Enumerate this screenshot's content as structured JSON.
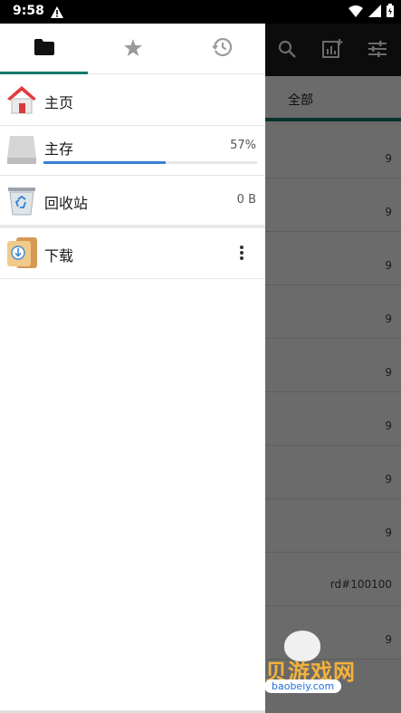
{
  "status_bar": {
    "time": "9:58",
    "icons": [
      "alert-icon",
      "wifi-icon",
      "signal-icon",
      "battery-icon"
    ]
  },
  "drawer": {
    "tabs": [
      {
        "icon": "folder-icon",
        "active": true
      },
      {
        "icon": "star-icon",
        "active": false
      },
      {
        "icon": "history-icon",
        "active": false
      }
    ],
    "items": {
      "home": {
        "label": "主页",
        "icon": "home-icon"
      },
      "storage": {
        "label": "主存",
        "percent": "57%",
        "progress": 0.57,
        "icon": "drive-icon"
      },
      "recycle": {
        "label": "回收站",
        "size": "0 B",
        "icon": "recycle-bin-icon"
      },
      "downloads": {
        "label": "下载",
        "icon": "downloads-folder-icon"
      }
    },
    "accent": "#127a6b",
    "progress_color": "#3a7fd5"
  },
  "background": {
    "toolbar_icons": [
      "search-icon",
      "add-chart-icon",
      "filter-sliders-icon"
    ],
    "tab_label": "全部",
    "rows": [
      "9",
      "9",
      "9",
      "9",
      "9",
      "9",
      "9",
      "9",
      "9",
      "9"
    ],
    "partial_text": "rd#100100"
  },
  "watermark": {
    "title": "宝贝游戏网",
    "domain": "baobeiy.com"
  }
}
